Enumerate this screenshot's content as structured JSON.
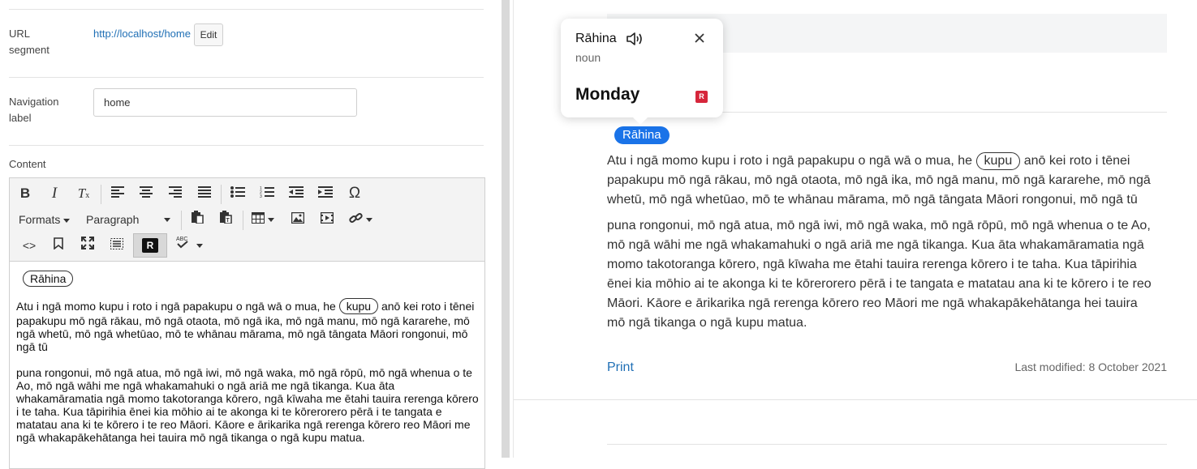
{
  "form": {
    "url_label_line1": "URL",
    "url_label_line2": "segment",
    "url_value": "http://localhost/home",
    "edit_label": "Edit",
    "nav_label_line1": "Navigation",
    "nav_label_line2": "label",
    "nav_value": "home",
    "content_label": "Content"
  },
  "toolbar": {
    "formats_label": "Formats",
    "paragraph_label": "Paragraph",
    "icons": [
      "bold-icon",
      "italic-icon",
      "clear-formatting-icon",
      "align-left-icon",
      "align-center-icon",
      "align-right-icon",
      "justify-icon",
      "bullet-list-icon",
      "numbered-list-icon",
      "outdent-icon",
      "indent-icon",
      "special-char-icon",
      "paste-icon",
      "paste-text-icon",
      "table-icon",
      "image-icon",
      "media-icon",
      "link-icon",
      "source-code-icon",
      "bookmark-icon",
      "fullscreen-icon",
      "visual-blocks-icon",
      "reo-icon",
      "spellcheck-icon"
    ],
    "reo_badge": "R",
    "spell_badge": "ABC"
  },
  "editor": {
    "pill_word": "Rāhina",
    "para1_a": "Atu i ngā momo kupu i roto i ngā papakupu o ngā wā o mua, he",
    "para1_kupu": "kupu",
    "para1_b": "anō kei roto i tēnei papakupu mō ngā rākau, mō ngā otaota, mō ngā ika, mō ngā manu, mō ngā kararehe, mō ngā whetū, mō ngā whetūao, mō te whānau mārama, mō ngā tāngata Māori rongonui, mō ngā tū",
    "para2": "puna rongonui, mō ngā atua, mō ngā iwi, mō ngā waka, mō ngā rōpū, mō ngā whenua o te Ao, mō ngā wāhi me ngā whakamahuki o ngā ariā me ngā tikanga. Kua āta whakamāramatia ngā momo takotoranga kōrero, ngā kīwaha me ētahi tauira rerenga kōrero i te taha. Kua tāpirihia ēnei kia mōhio ai te akonga ki te kōrerorero pērā i te tangata e matatau ana ki te kōrero i te reo Māori. Kāore e ārikarika ngā rerenga kōrero reo Māori me ngā whakapākehātanga hei tauira mō ngā tikanga o ngā kupu matua."
  },
  "preview": {
    "pill_word": "Rāhina",
    "para1_a": "Atu i ngā momo kupu i roto i ngā papakupu o ngā wā o mua, he",
    "para1_kupu": "kupu",
    "para1_b": "anō kei roto i tēnei papakupu mō ngā rākau, mō ngā otaota, mō ngā ika, mō ngā manu, mō ngā kararehe, mō ngā whetū, mō ngā whetūao, mō te whānau mārama, mō ngā tāngata Māori rongonui, mō ngā tū",
    "para2": "puna rongonui, mō ngā atua, mō ngā iwi, mō ngā waka, mō ngā rōpū, mō ngā whenua o te Ao, mō ngā wāhi me ngā whakamahuki o ngā ariā me ngā tikanga. Kua āta whakamāramatia ngā momo takotoranga kōrero, ngā kīwaha me ētahi tauira rerenga kōrero i te taha. Kua tāpirihia ēnei kia mōhio ai te akonga ki te kōrerorero pērā i te tangata e matatau ana ki te kōrero i te reo Māori. Kāore e ārikarika ngā rerenga kōrero reo Māori me ngā whakapākehātanga hei tauira mō ngā tikanga o ngā kupu matua.",
    "print_label": "Print",
    "modified": "Last modified: 8 October 2021"
  },
  "popup": {
    "word": "Rāhina",
    "pos": "noun",
    "translation": "Monday",
    "logo_letter": "R"
  },
  "colors": {
    "accent": "#1a73e8",
    "link": "#1f6fb5",
    "logo_red": "#d6263b"
  }
}
